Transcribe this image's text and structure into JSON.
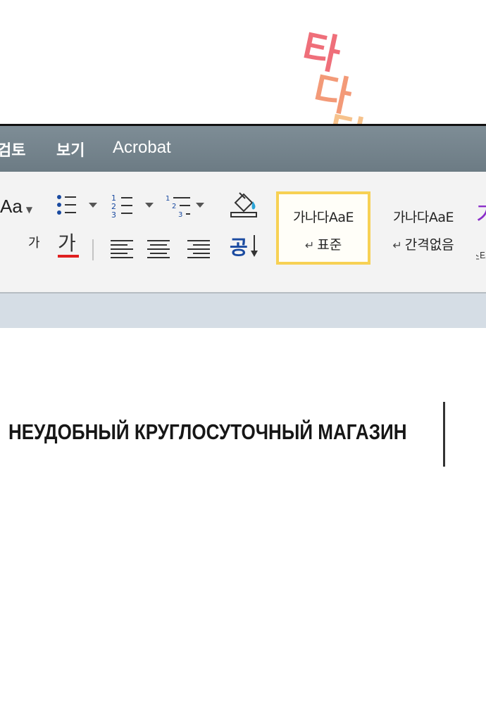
{
  "sound_effect": {
    "chars": [
      "타",
      "다",
      "닥"
    ],
    "colors": [
      "#ef6f7a",
      "#f39a78",
      "#f6c28c"
    ]
  },
  "menu": {
    "items": [
      "검토",
      "보기",
      "Acrobat"
    ]
  },
  "ribbon": {
    "font_size_label": "Aa",
    "char_small": "가",
    "char_color": "가",
    "font_color_accent": "#e02020",
    "paragraph_sort_char": "공",
    "styles": [
      {
        "sample": "가나다AaE",
        "name": "표준",
        "selected": true
      },
      {
        "sample": "가나다AaE",
        "name": "간격없음",
        "selected": false
      }
    ],
    "next_style_peek": {
      "sample": "가",
      "label": "스타"
    }
  },
  "document": {
    "title": "НЕУДОБНЫЙ КРУГЛОСУТОЧНЫЙ МАГАЗИН"
  }
}
